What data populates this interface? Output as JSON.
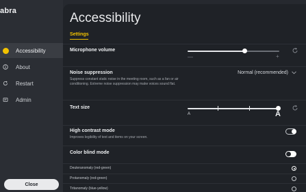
{
  "app": {
    "brand": "abra"
  },
  "sidebar": {
    "items": [
      {
        "label": "Accessibility",
        "icon": "accessibility-icon",
        "active": true
      },
      {
        "label": "About",
        "icon": "info-icon",
        "active": false
      },
      {
        "label": "Restart",
        "icon": "restart-icon",
        "active": false
      },
      {
        "label": "Admin",
        "icon": "admin-icon",
        "active": false
      }
    ],
    "close_label": "Close"
  },
  "page": {
    "title": "Accessibility",
    "tab": "Settings"
  },
  "settings": {
    "microphone_volume": {
      "label": "Microphone volume",
      "level": 0.62,
      "minus": "—",
      "plus": "+"
    },
    "noise_suppression": {
      "label": "Noise suppression",
      "description": "Suppress constant static noise in the meeting room, such as a fan or air conditioning. Extreme noise suppression may make voices sound flat.",
      "value": "Normal (recommended)"
    },
    "text_size": {
      "label": "Text size",
      "small_glyph": "A",
      "large_glyph": "A",
      "steps": 4,
      "selected_step": 4
    },
    "high_contrast": {
      "label": "High contrast mode",
      "description": "Improves legibility of text and items on your screen.",
      "enabled": false
    },
    "color_blind": {
      "label": "Color blind mode",
      "enabled": true,
      "options": [
        {
          "label": "Deuteranomaly (red-green)",
          "selected": true
        },
        {
          "label": "Protanomaly (red-green)",
          "selected": false
        },
        {
          "label": "Tritanomaly (blue-yellow)",
          "selected": false
        }
      ]
    }
  },
  "colors": {
    "accent": "#f2c200",
    "background": "#1f2227",
    "sidebar": "#2b2e34"
  }
}
